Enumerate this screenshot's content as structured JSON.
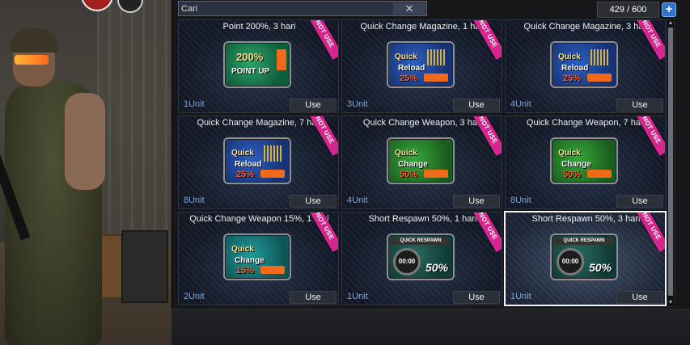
{
  "search": {
    "placeholder": "Cari",
    "clear_icon": "✕"
  },
  "inventory": {
    "count": "429 / 600",
    "add_icon": "+"
  },
  "items": [
    {
      "title": "Point 200%, 3 hari",
      "ribbon": "NOT USE",
      "unit": "1Unit",
      "button": "Use",
      "icon": "point-up-icon",
      "icon_text": [
        "200%",
        "POINT UP",
        ""
      ]
    },
    {
      "title": "Quick Change Magazine, 1 hari",
      "ribbon": "NOT USE",
      "unit": "3Unit",
      "button": "Use",
      "icon": "quick-reload-icon",
      "icon_text": [
        "Quick",
        "Reload",
        "25%"
      ]
    },
    {
      "title": "Quick Change Magazine, 3 hari",
      "ribbon": "NOT USE",
      "unit": "4Unit",
      "button": "Use",
      "icon": "quick-reload-icon",
      "icon_text": [
        "Quick",
        "Reload",
        "25%"
      ]
    },
    {
      "title": "Quick Change Magazine, 7 hari",
      "ribbon": "NOT USE",
      "unit": "8Unit",
      "button": "Use",
      "icon": "quick-reload-icon",
      "icon_text": [
        "Quick",
        "Reload",
        "25%"
      ]
    },
    {
      "title": "Quick Change Weapon, 3 hari",
      "ribbon": "NOT USE",
      "unit": "4Unit",
      "button": "Use",
      "icon": "quick-change-icon",
      "icon_text": [
        "Quick",
        "Change",
        "50%"
      ]
    },
    {
      "title": "Quick Change Weapon, 7 hari",
      "ribbon": "NOT USE",
      "unit": "8Unit",
      "button": "Use",
      "icon": "quick-change-icon",
      "icon_text": [
        "Quick",
        "Change",
        "50%"
      ]
    },
    {
      "title": "Quick Change Weapon 15%, 1 hari",
      "ribbon": "NOT USE",
      "unit": "2Unit",
      "button": "Use",
      "icon": "quick-change-icon",
      "icon_text": [
        "Quick",
        "Change",
        "15%"
      ]
    },
    {
      "title": "Short Respawn 50%, 1 hari",
      "ribbon": "NOT USE",
      "unit": "1Unit",
      "button": "Use",
      "icon": "quick-respawn-icon",
      "icon_text": [
        "QUICK RESPAWN",
        "00:00",
        "50%"
      ]
    },
    {
      "title": "Short Respawn 50%, 3 hari",
      "ribbon": "NOT USE",
      "unit": "1Unit",
      "button": "Use",
      "icon": "quick-respawn-icon",
      "icon_text": [
        "QUICK RESPAWN",
        "00:00",
        "50%"
      ]
    }
  ],
  "selected_index": 8,
  "colors": {
    "ribbon": "#d6258f",
    "unit_text": "#7fa3d8",
    "add_button": "#2f74c9",
    "selected_border": "#f2f2f2"
  }
}
